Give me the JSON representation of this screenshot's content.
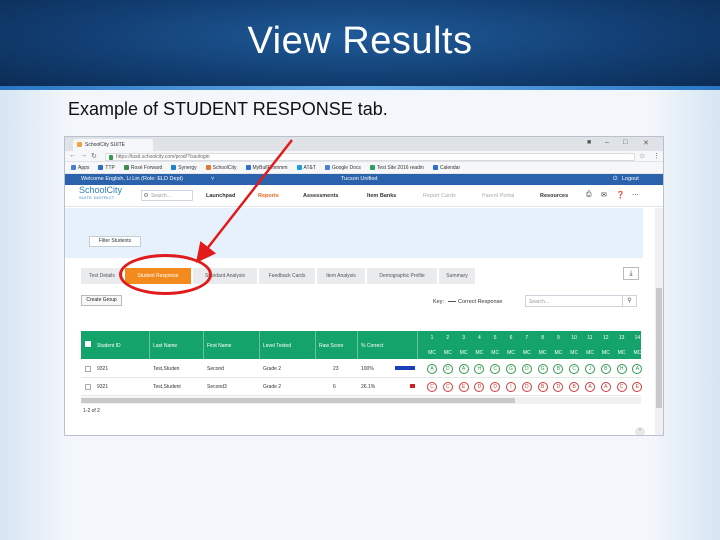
{
  "slide": {
    "title": "View Results",
    "subtitle": "Example of STUDENT RESPONSE tab."
  },
  "browser": {
    "tab_title": "SchoolCity SUITE",
    "url": "https://tusd.schoolcity.com/prod/?/ssologin",
    "bookmarks": [
      {
        "label": "Apps",
        "color": "#4a7fd6"
      },
      {
        "label": "TTP",
        "color": "#2d6fb8"
      },
      {
        "label": "Rosé Forward",
        "color": "#3e8d4b"
      },
      {
        "label": "Synergy",
        "color": "#1e84c6"
      },
      {
        "label": "SchoolCity",
        "color": "#e27a2f"
      },
      {
        "label": "MyBullEmmmm",
        "color": "#2f6dd0"
      },
      {
        "label": "AT&T",
        "color": "#1a9dd9"
      },
      {
        "label": "Google Docs",
        "color": "#4a7fd6"
      },
      {
        "label": "Test Site 2016 readin",
        "color": "#2f9f62"
      },
      {
        "label": "Calendar",
        "color": "#2f6dd0"
      }
    ]
  },
  "app": {
    "welcome": "Welcome English, Li Lin (Role: ELD Dept)",
    "district": "Tucson Unified",
    "logout": "Logout",
    "logo_line1": "SchoolCity",
    "logo_line2": "SUITE DISTRICT",
    "search_placeholder": "Search...",
    "menu": [
      "Launchpad",
      "Reports",
      "Assessments",
      "Item Banks",
      "Report Cards",
      "Parent Portal",
      "Resources"
    ],
    "filter_students": "Filter Students"
  },
  "result_tabs": [
    "Test Details",
    "Student Response",
    "Standard Analysis",
    "Feedback Cards",
    "Item Analysis",
    "Demographic Profile",
    "Summary"
  ],
  "toolbar": {
    "create_group": "Create Group",
    "key_label": "Key:",
    "key_value": "Correct Response",
    "search_placeholder": "Search..."
  },
  "table": {
    "columns": [
      "Student ID",
      "Last Name",
      "First Name",
      "Level Tested",
      "Raw Score",
      "% Correct"
    ],
    "question_numbers": [
      "1",
      "2",
      "3",
      "4",
      "5",
      "6",
      "7",
      "8",
      "9",
      "10",
      "11",
      "12",
      "13",
      "14"
    ],
    "question_type": "MC",
    "rows": [
      {
        "student_id": "9321",
        "last_name": "Test,Studen",
        "first_name": "Second",
        "level": "Grade 2",
        "raw_score": "23",
        "pct": "100%",
        "pct_fraction": 1.0,
        "bar_color": "#1f3fb8",
        "responses": [
          {
            "letter": "A",
            "correct": true
          },
          {
            "letter": "D",
            "correct": true
          },
          {
            "letter": "A",
            "correct": true
          },
          {
            "letter": "H",
            "correct": true
          },
          {
            "letter": "C",
            "correct": true
          },
          {
            "letter": "G",
            "correct": true
          },
          {
            "letter": "D",
            "correct": true
          },
          {
            "letter": "G",
            "correct": true
          },
          {
            "letter": "B",
            "correct": true
          },
          {
            "letter": "C",
            "correct": true
          },
          {
            "letter": "J",
            "correct": true
          },
          {
            "letter": "B",
            "correct": true
          },
          {
            "letter": "H",
            "correct": true
          },
          {
            "letter": "A",
            "correct": true
          }
        ]
      },
      {
        "student_id": "9321",
        "last_name": "Test,Student",
        "first_name": "Second3",
        "level": "Grade 2",
        "raw_score": "6",
        "pct": "26.1%",
        "pct_fraction": 0.261,
        "bar_color": "#d01f1f",
        "responses": [
          {
            "letter": "C",
            "correct": false
          },
          {
            "letter": "C",
            "correct": false
          },
          {
            "letter": "E",
            "correct": false
          },
          {
            "letter": "D",
            "correct": false
          },
          {
            "letter": "D",
            "correct": false
          },
          {
            "letter": "I",
            "correct": false
          },
          {
            "letter": "D",
            "correct": false
          },
          {
            "letter": "B",
            "correct": false
          },
          {
            "letter": "D",
            "correct": false
          },
          {
            "letter": "B",
            "correct": false
          },
          {
            "letter": "A",
            "correct": false
          },
          {
            "letter": "A",
            "correct": false
          },
          {
            "letter": "C",
            "correct": false
          },
          {
            "letter": "E",
            "correct": false
          }
        ]
      }
    ],
    "pager": "1-2 of 2"
  },
  "colors": {
    "header_green": "#14a46b",
    "active_tab": "#f28a1d",
    "annotation_red": "#e11b1b",
    "correct": "#2e9c4a",
    "incorrect": "#d23a3a"
  }
}
